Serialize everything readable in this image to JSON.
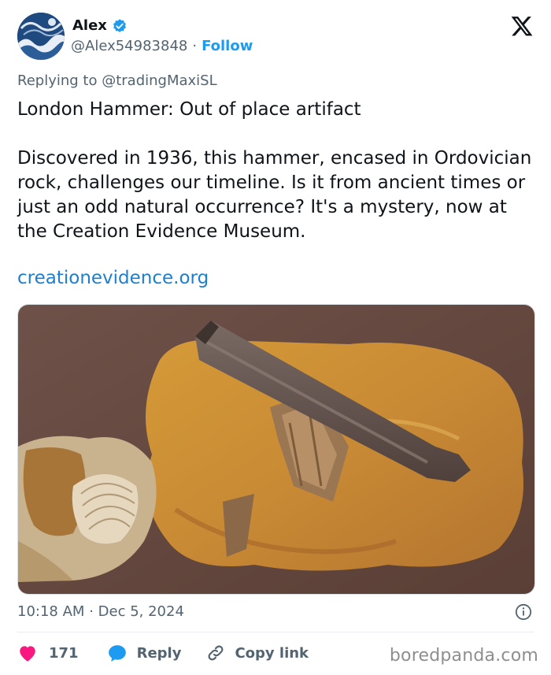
{
  "author": {
    "name": "Alex",
    "handle": "@Alex54983848",
    "separator": "·",
    "follow_label": "Follow"
  },
  "replying": {
    "prefix": "Replying to",
    "mention": "@tradingMaxiSL"
  },
  "tweet": {
    "text": "London Hammer: Out of place artifact\n\nDiscovered in 1936, this hammer, encased in Ordovician rock, challenges our timeline. Is it from ancient times or just an odd natural occurrence? It's a mystery, now at the Creation Evidence Museum.",
    "link": "creationevidence.org"
  },
  "meta": {
    "time": "10:18 AM",
    "separator": "·",
    "date": "Dec 5, 2024"
  },
  "actions": {
    "like_count": "171",
    "reply_label": "Reply",
    "copy_label": "Copy link"
  },
  "watermark": "boredpanda.com",
  "colors": {
    "accent": "#1d9bf0",
    "like": "#f91880",
    "text": "#0f1419",
    "muted": "#536471"
  },
  "icons": [
    "verified-badge-icon",
    "x-logo-icon",
    "info-icon",
    "heart-icon",
    "reply-bubble-icon",
    "link-icon"
  ]
}
